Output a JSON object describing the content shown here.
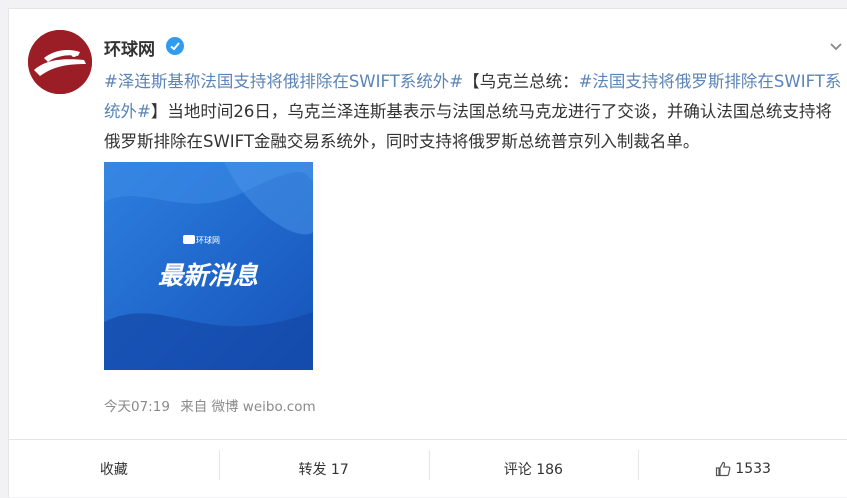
{
  "post": {
    "author": "环球网",
    "thumb_logo_text": "环球网",
    "segments": [
      {
        "text": "#泽连斯基称法国支持将俄排除在SWIFT系统外#",
        "tag": true
      },
      {
        "text": "【乌克兰总统：",
        "tag": false
      },
      {
        "text": "#法国支持将俄罗斯排除在SWIFT系统外#",
        "tag": true
      },
      {
        "text": "】当地时间26日，乌克兰泽连斯基表示与法国总统马克龙进行了交谈，并确认法国总统支持将俄罗斯排除在SWIFT金融交易系统外，同时支持将俄罗斯总统普京列入制裁名单。",
        "tag": false
      }
    ],
    "image_text": "最新消息",
    "time": "今天07:19",
    "source": "来自 微博 weibo.com"
  },
  "actions": {
    "favorite": "收藏",
    "repost": "转发 17",
    "comment": "评论 186",
    "like": "1533"
  },
  "colors": {
    "tag": "#5b84b7",
    "brand": "#9b1e26",
    "verified": "#2f9cf0",
    "image_blue": "#1e66d0"
  }
}
